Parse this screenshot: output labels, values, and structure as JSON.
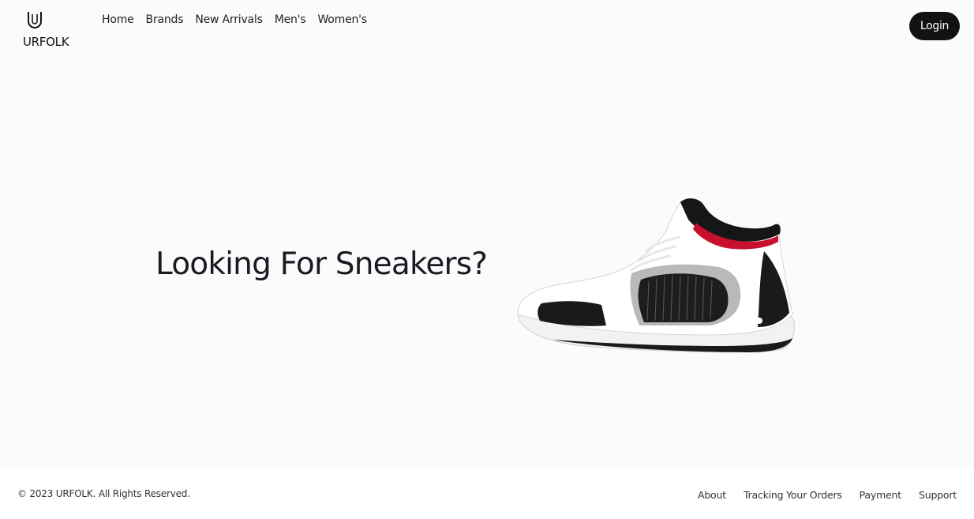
{
  "header": {
    "logo_text": "URFOLK",
    "logo_icon": "u-monogram-icon",
    "nav": [
      {
        "label": "Home"
      },
      {
        "label": "Brands"
      },
      {
        "label": "New Arrivals"
      },
      {
        "label": "Men's"
      },
      {
        "label": "Women's"
      }
    ],
    "login_label": "Login"
  },
  "hero": {
    "title": "Looking For Sneakers?",
    "image": "sneaker-image"
  },
  "footer": {
    "copyright": "© 2023 URFOLK. All Rights Reserved.",
    "links": [
      {
        "label": "About"
      },
      {
        "label": "Tracking Your Orders"
      },
      {
        "label": "Payment"
      },
      {
        "label": "Support"
      }
    ]
  },
  "colors": {
    "background": "#fbfafd",
    "button_bg": "#121212",
    "accent_red": "#c8102e"
  }
}
